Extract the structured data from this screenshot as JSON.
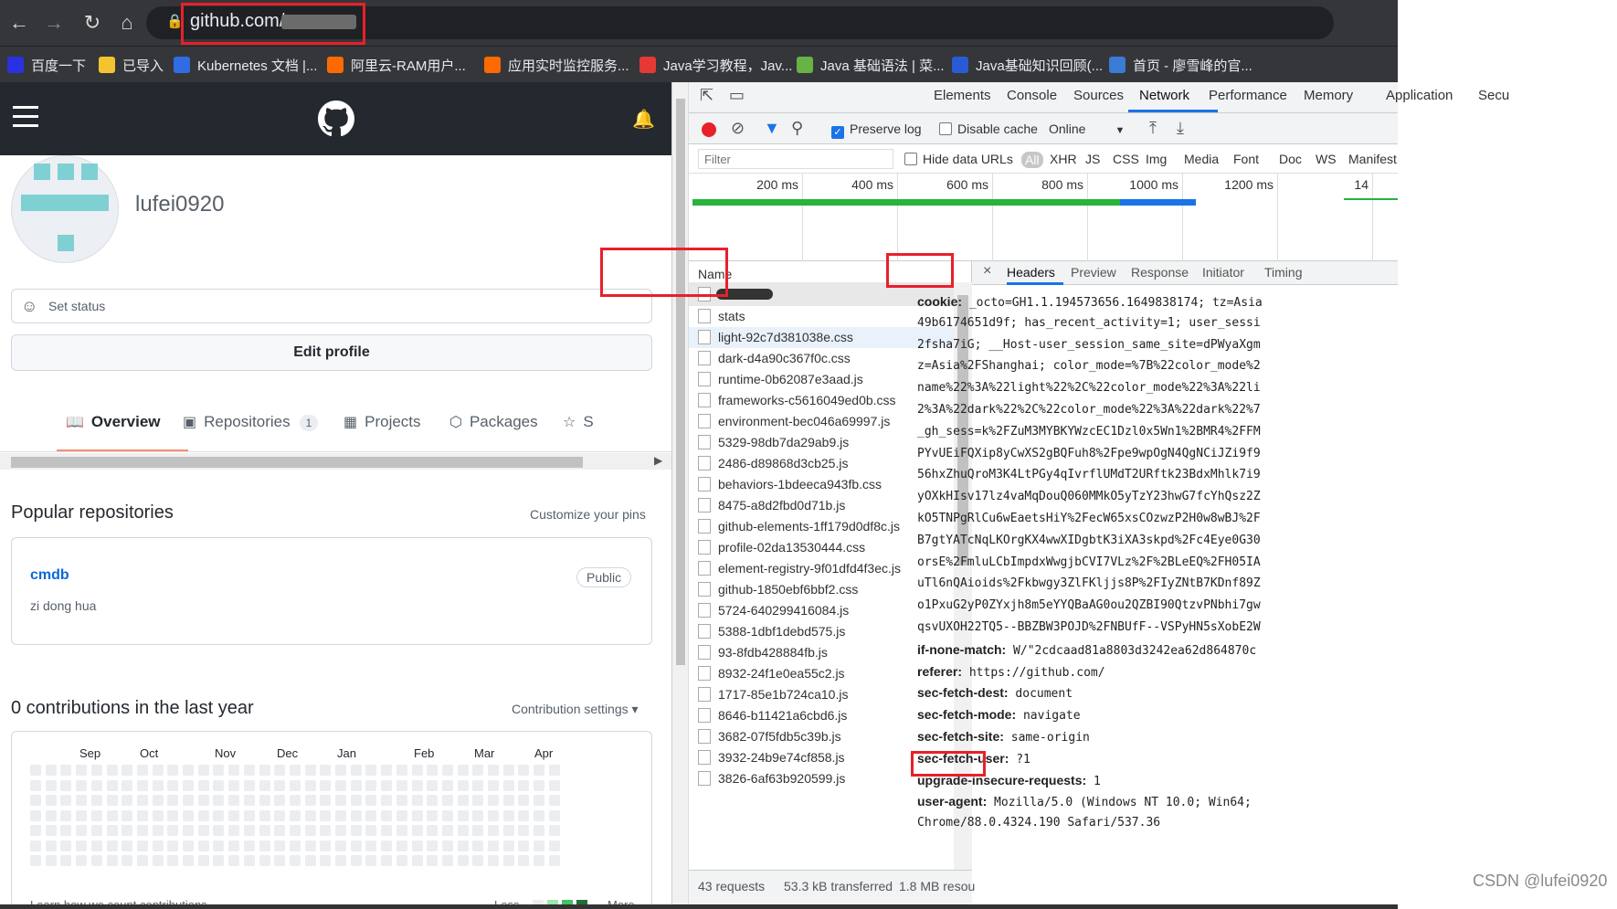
{
  "browser": {
    "url": "github.com/",
    "bookmarks": [
      {
        "label": "百度一下",
        "icon": "baidu-icon",
        "color": "#2932e1"
      },
      {
        "label": "已导入",
        "icon": "folder-icon",
        "color": "#f4c430"
      },
      {
        "label": "Kubernetes 文档 |...",
        "icon": "kubernetes-icon",
        "color": "#326ce5"
      },
      {
        "label": "阿里云-RAM用户...",
        "icon": "aliyun-icon",
        "color": "#ff6a00"
      },
      {
        "label": "应用实时监控服务...",
        "icon": "aliyun-icon",
        "color": "#ff6a00"
      },
      {
        "label": "Java学习教程，Jav...",
        "icon": "c-icon",
        "color": "#e53935"
      },
      {
        "label": "Java 基础语法 | 菜...",
        "icon": "runoob-icon",
        "color": "#67b346"
      },
      {
        "label": "Java基础知识回顾(...",
        "icon": "ps-icon",
        "color": "#2a5bd7"
      },
      {
        "label": "首页 - 廖雪峰的官...",
        "icon": "rocket-icon",
        "color": "#3a7bd5"
      }
    ]
  },
  "github": {
    "username": "lufei0920",
    "set_status": "Set status",
    "edit_profile": "Edit profile",
    "tabs": [
      {
        "label": "Overview",
        "icon": "book-icon"
      },
      {
        "label": "Repositories",
        "icon": "repo-icon",
        "count": "1"
      },
      {
        "label": "Projects",
        "icon": "project-icon"
      },
      {
        "label": "Packages",
        "icon": "package-icon"
      },
      {
        "label": "S",
        "icon": "star-icon"
      }
    ],
    "popular_title": "Popular repositories",
    "customize_pins": "Customize your pins",
    "repo": {
      "name": "cmdb",
      "badge": "Public",
      "desc": "zi dong hua"
    },
    "contrib_title": "0 contributions in the last year",
    "contrib_settings": "Contribution settings ▾",
    "months": [
      "Sep",
      "Oct",
      "Nov",
      "Dec",
      "Jan",
      "Feb",
      "Mar",
      "Apr"
    ],
    "learn": "Learn how we count contributions",
    "less": "Less",
    "more": "More"
  },
  "devtools": {
    "tabs": [
      "Elements",
      "Console",
      "Sources",
      "Network",
      "Performance",
      "Memory",
      "Application",
      "Secu"
    ],
    "active_tab": "Network",
    "preserve_log": "Preserve log",
    "disable_cache": "Disable cache",
    "online": "Online",
    "filter_placeholder": "Filter",
    "hide_data_urls": "Hide data URLs",
    "types": [
      "All",
      "XHR",
      "JS",
      "CSS",
      "Img",
      "Media",
      "Font",
      "Doc",
      "WS",
      "Manifest"
    ],
    "timeline": [
      "200 ms",
      "400 ms",
      "600 ms",
      "800 ms",
      "1000 ms",
      "1200 ms",
      "14"
    ],
    "name_header": "Name",
    "files": [
      "stats",
      "light-92c7d381038e.css",
      "dark-d4a90c367f0c.css",
      "runtime-0b62087e3aad.js",
      "frameworks-c5616049ed0b.css",
      "environment-bec046a69997.js",
      "5329-98db7da29ab9.js",
      "2486-d89868d3cb25.js",
      "behaviors-1bdeeca943fb.css",
      "8475-a8d2fbd0d71b.js",
      "github-elements-1ff179d0df8c.js",
      "profile-02da13530444.css",
      "element-registry-9f01dfd4f3ec.js",
      "github-1850ebf6bbf2.css",
      "5724-640299416084.js",
      "5388-1dbf1debd575.js",
      "93-8fdb428884fb.js",
      "8932-24f1e0ea55c2.js",
      "1717-85e1b724ca10.js",
      "8646-b11421a6cbd6.js",
      "3682-07f5fdb5c39b.js",
      "3932-24b9e74cf858.js",
      "3826-6af63b920599.js"
    ],
    "detail_tabs": [
      "Headers",
      "Preview",
      "Response",
      "Initiator",
      "Timing"
    ],
    "headers": [
      {
        "k": "cookie:",
        "v": " _octo=GH1.1.194573656.1649838174; tz=Asia"
      },
      {
        "k": "",
        "v": "49b6174651d9f; has_recent_activity=1; user_sessi"
      },
      {
        "k": "",
        "v": "2fsha7iG; __Host-user_session_same_site=dPWyaXgm"
      },
      {
        "k": "",
        "v": "z=Asia%2FShanghai; color_mode=%7B%22color_mode%2"
      },
      {
        "k": "",
        "v": "name%22%3A%22light%22%2C%22color_mode%22%3A%22li"
      },
      {
        "k": "",
        "v": "2%3A%22dark%22%2C%22color_mode%22%3A%22dark%22%7"
      },
      {
        "k": "",
        "v": "_gh_sess=k%2FZuM3MYBKYWzcEC1Dzl0x5Wn1%2BMR4%2FFM"
      },
      {
        "k": "",
        "v": "PYvUEiFQXip8yCwXS2gBQFuh8%2Fpe9wpOgN4QgNCiJZi9f9"
      },
      {
        "k": "",
        "v": "56hxZhuQroM3K4LtPGy4qIvrflUMdT2URftk23BdxMhlk7i9"
      },
      {
        "k": "",
        "v": "yOXkHIsv17lz4vaMqDouQ060MMkO5yTzY23hwG7fcYhQsz2Z"
      },
      {
        "k": "",
        "v": "kO5TNPgRlCu6wEaetsHiY%2FecW65xsCOzwzP2H0w8wBJ%2F"
      },
      {
        "k": "",
        "v": "B7gtYATcNqLKOrgKX4wwXIDgbtK3iXA3skpd%2Fc4Eye0G30"
      },
      {
        "k": "",
        "v": "orsE%2FmluLCbImpdxWwgjbCVI7VLz%2F%2BLeEQ%2FH05IA"
      },
      {
        "k": "",
        "v": "uTl6nQAioids%2Fkbwgy3ZlFKljjs8P%2FIyZNtB7KDnf89Z"
      },
      {
        "k": "",
        "v": "o1PxuG2yP0ZYxjh8m5eYYQBaAG0ou2QZBI90QtzvPNbhi7gw"
      },
      {
        "k": "",
        "v": "qsvUXOH22TQ5--BBZBW3POJD%2FNBUfF--VSPyHN5sXobE2W"
      },
      {
        "k": "if-none-match:",
        "v": " W/\"2cdcaad81a8803d3242ea62d864870c"
      },
      {
        "k": "referer:",
        "v": " https://github.com/"
      },
      {
        "k": "sec-fetch-dest:",
        "v": " document"
      },
      {
        "k": "sec-fetch-mode:",
        "v": " navigate"
      },
      {
        "k": "sec-fetch-site:",
        "v": " same-origin"
      },
      {
        "k": "sec-fetch-user:",
        "v": " ?1"
      },
      {
        "k": "upgrade-insecure-requests:",
        "v": " 1"
      },
      {
        "k": "user-agent:",
        "v": " Mozilla/5.0 (Windows NT 10.0; Win64; "
      },
      {
        "k": "",
        "v": "Chrome/88.0.4324.190 Safari/537.36"
      }
    ],
    "summary": [
      "43 requests",
      "53.3 kB transferred",
      "1.8 MB resou"
    ]
  },
  "watermark": "CSDN @lufei0920"
}
